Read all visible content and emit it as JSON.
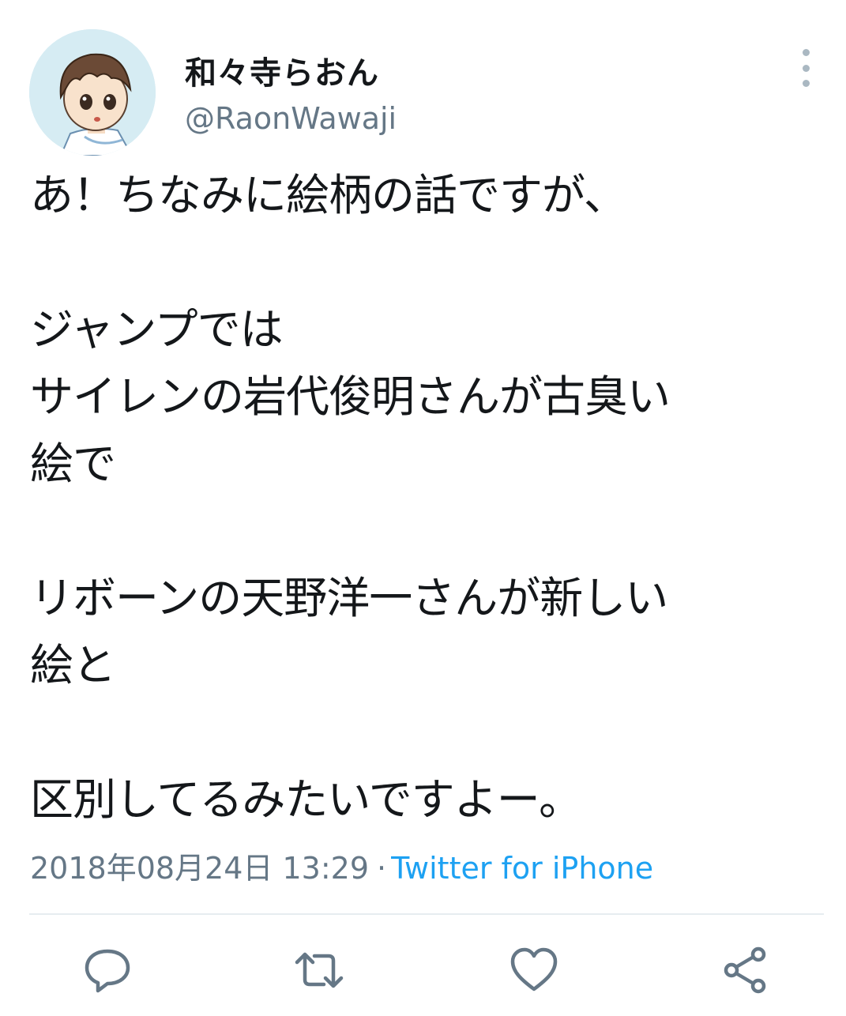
{
  "author": {
    "display_name": "和々寺らおん",
    "handle": "@RaonWawaji",
    "avatar_icon": "anime-boy-avatar"
  },
  "tweet": {
    "lines": [
      "あ！ちなみに絵柄の話ですが、",
      "",
      "ジャンプでは",
      "サイレンの岩代俊明さんが古臭い",
      "絵で",
      "",
      "リボーンの天野洋一さんが新しい",
      "絵と",
      "",
      "区別してるみたいですよー。"
    ],
    "timestamp": "2018年08月24日 13:29",
    "separator": "·",
    "client": "Twitter for iPhone"
  },
  "actions": {
    "reply_icon": "speech-bubble-icon",
    "retweet_icon": "retweet-icon",
    "like_icon": "heart-icon",
    "share_icon": "share-icon"
  },
  "colors": {
    "text": "#14171a",
    "secondary": "#657786",
    "link": "#1da1f2",
    "icon": "#657786",
    "divider": "#e6ecf0"
  }
}
